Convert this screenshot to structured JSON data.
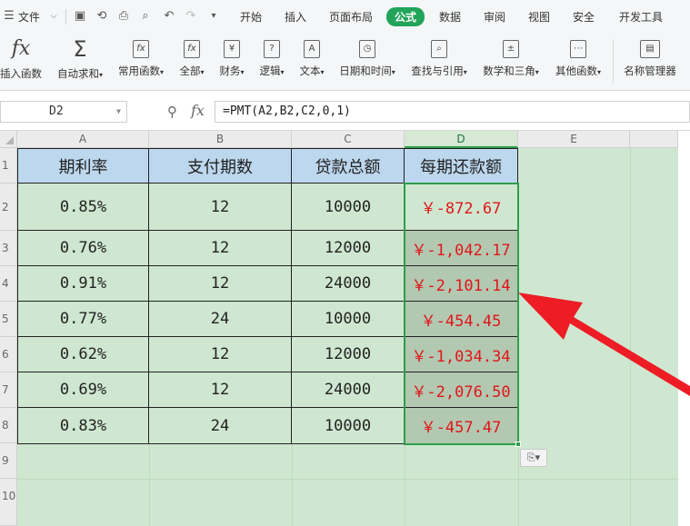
{
  "menubar": {
    "file": "文件",
    "tabs": [
      "开始",
      "插入",
      "页面布局",
      "公式",
      "数据",
      "审阅",
      "视图",
      "安全",
      "开发工具"
    ],
    "active_tab": "公式"
  },
  "ribbon": {
    "buttons": [
      {
        "label": "插入函数",
        "icon": "fx"
      },
      {
        "label": "自动求和",
        "icon": "Σ"
      },
      {
        "label": "常用函数",
        "icon": "fx"
      },
      {
        "label": "全部",
        "icon": "fx"
      },
      {
        "label": "财务",
        "icon": "¥"
      },
      {
        "label": "逻辑",
        "icon": "?"
      },
      {
        "label": "文本",
        "icon": "A"
      },
      {
        "label": "日期和时间",
        "icon": "◷"
      },
      {
        "label": "查找与引用",
        "icon": "⌕"
      },
      {
        "label": "数学和三角",
        "icon": "±"
      },
      {
        "label": "其他函数",
        "icon": "⋯"
      },
      {
        "label": "名称管理器",
        "icon": "▤"
      }
    ]
  },
  "formula_bar": {
    "name_box": "D2",
    "formula": "=PMT(A2,B2,C2,0,1)"
  },
  "sheet": {
    "columns": [
      "A",
      "B",
      "C",
      "D",
      "E"
    ],
    "rows": [
      "1",
      "2",
      "3",
      "4",
      "5",
      "6",
      "7",
      "8",
      "9",
      "10"
    ],
    "headers": [
      "期利率",
      "支付期数",
      "贷款总额",
      "每期还款额"
    ],
    "data": [
      [
        "0.85%",
        "12",
        "10000",
        "￥-872.67"
      ],
      [
        "0.76%",
        "12",
        "12000",
        "￥-1,042.17"
      ],
      [
        "0.91%",
        "12",
        "24000",
        "￥-2,101.14"
      ],
      [
        "0.77%",
        "24",
        "10000",
        "￥-454.45"
      ],
      [
        "0.62%",
        "12",
        "12000",
        "￥-1,034.34"
      ],
      [
        "0.69%",
        "12",
        "24000",
        "￥-2,076.50"
      ],
      [
        "0.83%",
        "24",
        "10000",
        "￥-457.47"
      ]
    ],
    "selected_cell": "D2",
    "selected_column": "D"
  },
  "paste_options": "⎘▾",
  "colors": {
    "active_tab": "#22a45a",
    "header_fill": "#bdd7ee",
    "sheet_bg": "#cfe7d0",
    "result_text": "#e0161a",
    "arrow": "#ee1c24"
  }
}
